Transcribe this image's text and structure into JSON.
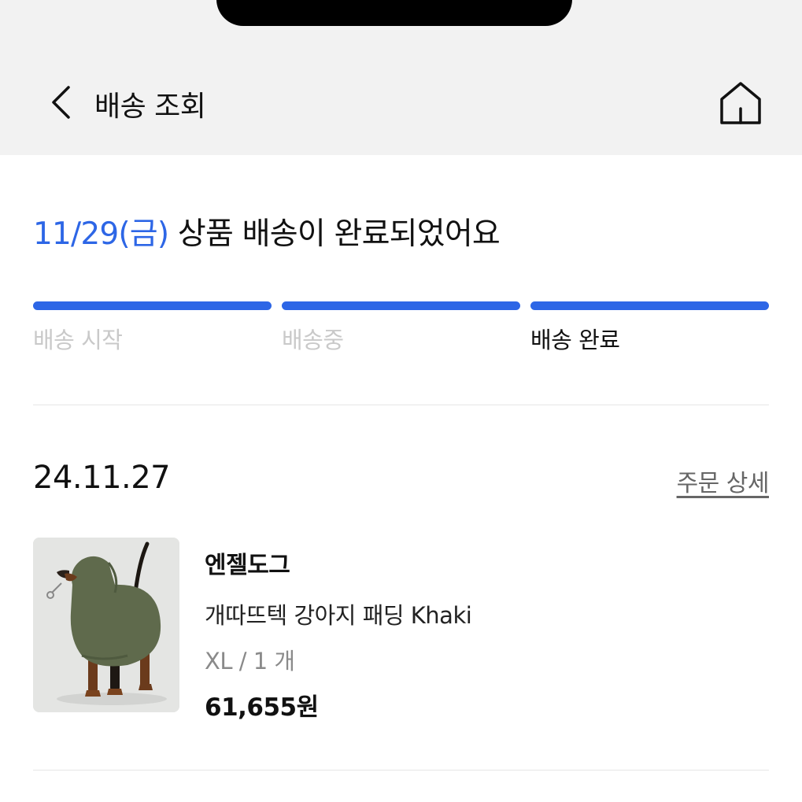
{
  "header": {
    "title": "배송 조회",
    "back_icon": "chevron-left-icon",
    "home_icon": "home-icon"
  },
  "status": {
    "date": "11/29(금)",
    "message": "상품 배송이 완료되었어요",
    "accent_color": "#2d66e6"
  },
  "progress": {
    "steps": [
      {
        "label": "배송 시작",
        "active": false
      },
      {
        "label": "배송중",
        "active": false
      },
      {
        "label": "배송 완료",
        "active": true
      }
    ]
  },
  "order": {
    "date": "24.11.27",
    "detail_link": "주문 상세"
  },
  "product": {
    "brand": "엔젤도그",
    "name": "개따뜨텍 강아지 패딩 Khaki",
    "option": "XL / 1 개",
    "price": "61,655원",
    "image": "dog-in-khaki-padding-photo"
  }
}
